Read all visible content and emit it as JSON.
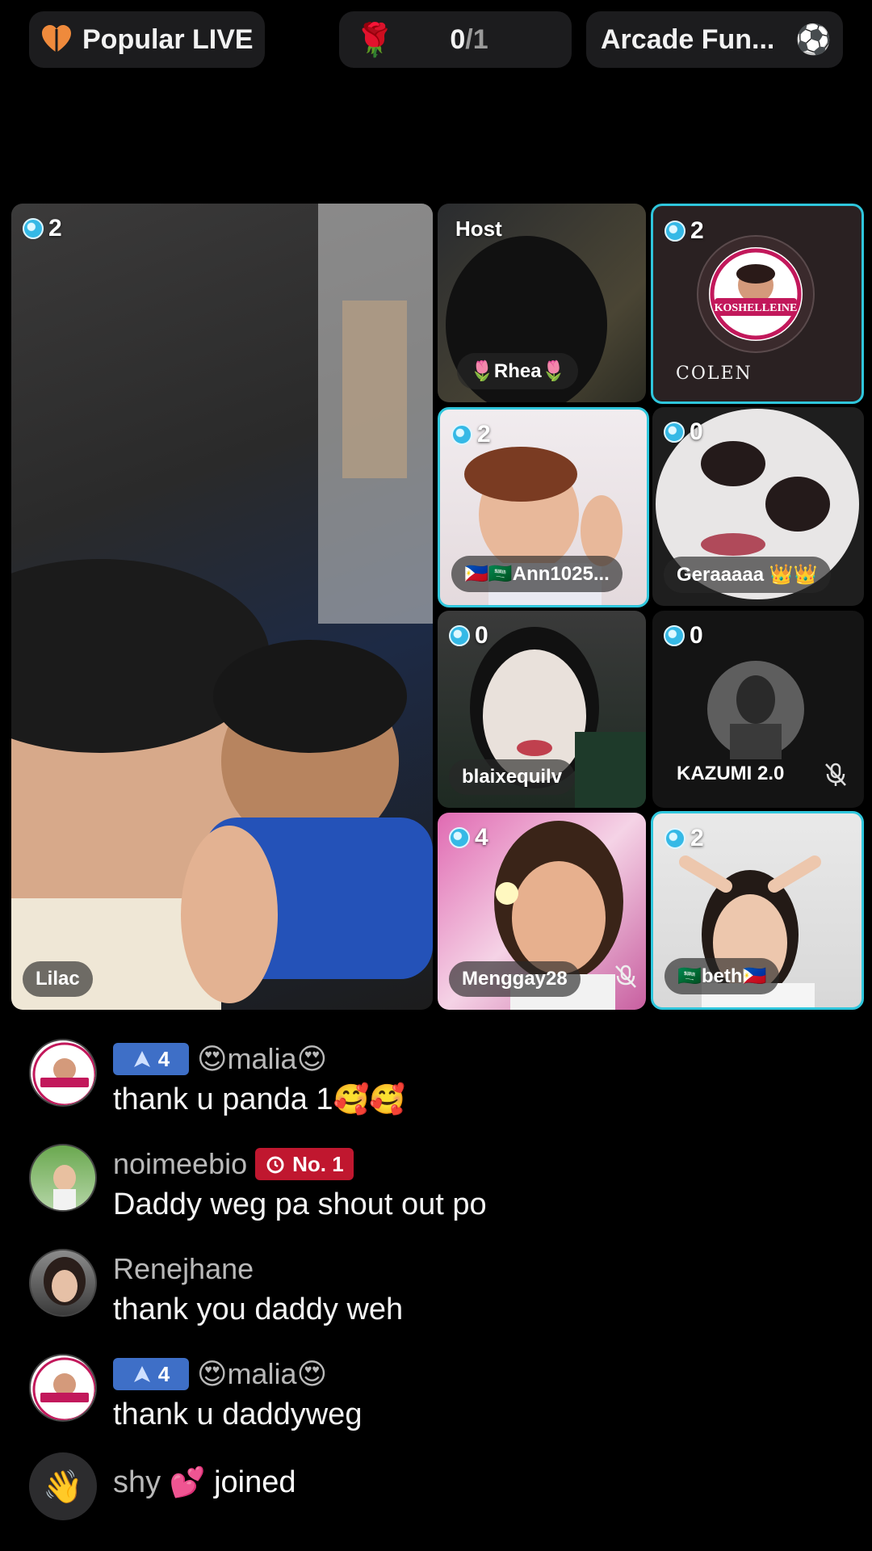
{
  "topbar": {
    "popular_label": "Popular LIVE",
    "rose_current": "0",
    "rose_total": "/1",
    "arcade_label": "Arcade Fun...",
    "rose_icon": "rose-icon",
    "ball_icon": "soccer-ball-icon"
  },
  "colors": {
    "active_border": "#2fc6dc",
    "level_badge": "#3e6fc7",
    "rank_badge": "#c0172f"
  },
  "guests": {
    "main": {
      "name": "Lilac",
      "gems": "2"
    },
    "host": {
      "label": "Host",
      "name": "Rhea"
    },
    "colen": {
      "name": "COLEN",
      "gems": "2",
      "logo_text": "KOSHELLEINE"
    },
    "ann": {
      "name": "Ann1025...",
      "gems": "2"
    },
    "geraaaa": {
      "name": "Geraaaaa",
      "gems": "0"
    },
    "blaixe": {
      "name": "blaixequilv",
      "gems": "0"
    },
    "kazumi": {
      "name": "KAZUMI 2.0",
      "gems": "0"
    },
    "menggay": {
      "name": "Menggay28",
      "gems": "4"
    },
    "beth": {
      "name": "beth",
      "gems": "2"
    }
  },
  "chat": [
    {
      "user": "malia",
      "level": "4",
      "message": "thank u panda 1"
    },
    {
      "user": "noimeebio",
      "rank": "No. 1",
      "message": "Daddy weg pa shout out po"
    },
    {
      "user": "Renejhane",
      "message": "thank you daddy weh"
    },
    {
      "user": "malia",
      "level": "4",
      "message": "thank u daddyweg"
    }
  ],
  "joined": {
    "user": "shy",
    "text": "joined"
  }
}
